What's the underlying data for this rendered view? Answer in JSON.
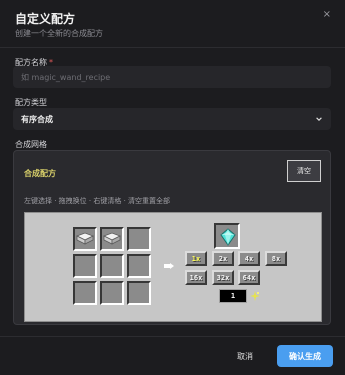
{
  "dialog": {
    "title": "自定义配方",
    "subtitle": "创建一个全新的合成配方",
    "close_glyph": "×"
  },
  "form": {
    "name_label": "配方名称",
    "required_mark": "*",
    "name_value": "",
    "name_placeholder": "如 magic_wand_recipe",
    "type_label": "配方类型",
    "type_value": "有序合成",
    "grid_label": "合成网格"
  },
  "panel": {
    "title": "合成配方",
    "clear_label": "清空",
    "hint": "左键选择 · 拖拽换位 · 右键清格 · 清空重置全部"
  },
  "crafting": {
    "slots": [
      "paper",
      "paper",
      "",
      "",
      "",
      "",
      "",
      "",
      ""
    ],
    "result_item": "diamond",
    "quantity_options": [
      "1x",
      "2x",
      "4x",
      "8x",
      "16x",
      "32x",
      "64x"
    ],
    "active_quantity": "1x",
    "quantity_value": "1"
  },
  "footer": {
    "cancel_label": "取消",
    "confirm_label": "确认生成"
  },
  "colors": {
    "accent": "#4a9ef0",
    "panel_title": "#d9d06a",
    "minecraft_bg": "#c6c6c6",
    "slot_bg": "#8b8b8b",
    "active_quantity": "#ffff55"
  }
}
